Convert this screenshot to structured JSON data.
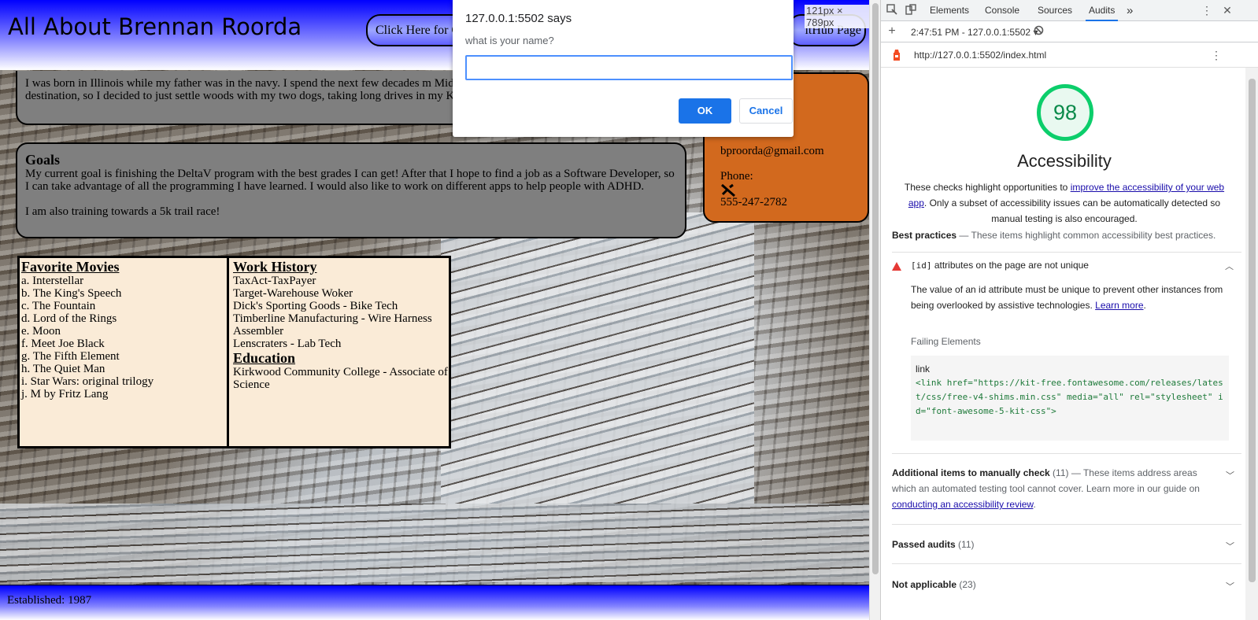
{
  "site": {
    "title": "All About Brennan Roorda",
    "header_buttons": [
      "Click Here for C",
      "itHub Page"
    ],
    "about_text": "I was born in Illinois while my father was in the navy. I spend the next few decades m Midwest. Iowa seemed to be the most common destination, so I decided to just settle woods with my two dogs, taking long drives in my Kia, and reading a good sci-fi/fan",
    "goals": {
      "title": "Goals",
      "text1": "My current goal is finishing the DeltaV program with the best grades I can get! After that I hope to find a job as a Software Developer, so I can take advantage of all the programming I have learned. I would also like to work on different apps to help people with ADHD.",
      "text2": "I am also training towards a 5k trail race!"
    },
    "contact": {
      "email": "bproorda@gmail.com",
      "phone_label": "Phone:",
      "phone": "555-247-2782"
    },
    "movies": {
      "title": "Favorite Movies",
      "items": [
        "a. Interstellar",
        "b. The King's Speech",
        "c. The Fountain",
        "d. Lord of the Rings",
        "e. Moon",
        "f. Meet Joe Black",
        "g. The Fifth Element",
        "h. The Quiet Man",
        "i. Star Wars: original trilogy",
        "j. M by Fritz Lang"
      ]
    },
    "work": {
      "title": "Work History",
      "items": [
        "TaxAct-TaxPayer",
        "Target-Warehouse Woker",
        "Dick's Sporting Goods - Bike Tech",
        "Timberline Manufacturing - Wire Harness Assembler",
        "Lenscraters - Lab Tech"
      ]
    },
    "education": {
      "title": "Education",
      "items": [
        "Kirkwood Community College - Associate of Science"
      ]
    },
    "footer": "Established: 1987",
    "size_badge": "121px × 789px"
  },
  "alert": {
    "origin": "127.0.0.1:5502 says",
    "message": "what is your name?",
    "input_value": "",
    "ok": "OK",
    "cancel": "Cancel"
  },
  "devtools": {
    "tabs": [
      "Elements",
      "Console",
      "Sources",
      "Audits"
    ],
    "more_tabs": "»",
    "run": "2:47:51 PM - 127.0.0.1:5502 ▾",
    "url": "http://127.0.0.1:5502/index.html",
    "score": "98",
    "category": "Accessibility",
    "desc_pre": "These checks highlight opportunities to ",
    "desc_link": "improve the accessibility of your web app",
    "desc_post": ". Only a subset of accessibility issues can be automatically detected so manual testing is also encouraged.",
    "best_practices": {
      "title": "Best practices",
      "text": " — These items highlight common accessibility best practices."
    },
    "audit": {
      "code": "[id]",
      "title": " attributes on the page are not unique",
      "desc": "The value of an id attribute must be unique to prevent other instances from being overlooked by assistive technologies. ",
      "learn_more": "Learn more",
      "failing_label": "Failing Elements",
      "node": "link",
      "snippet": "<link href=\"https://kit-free.fontawesome.com/releases/latest/css/free-v4-shims.min.css\" media=\"all\" rel=\"stylesheet\" id=\"font-awesome-5-kit-css\">"
    },
    "manual": {
      "title": "Additional items to manually check",
      "count": " (11)",
      "text": "  — These items address areas which an automated testing tool cannot cover. Learn more in our guide on ",
      "link": "conducting an accessibility review"
    },
    "passed": {
      "title": "Passed audits",
      "count": " (11)"
    },
    "na": {
      "title": "Not applicable",
      "count": " (23)"
    }
  },
  "colors": {
    "score_green": "#0cce6b",
    "contact_orange": "#d2691e",
    "table_bg": "#faebd7",
    "dialog_blue": "#1a73e8"
  }
}
